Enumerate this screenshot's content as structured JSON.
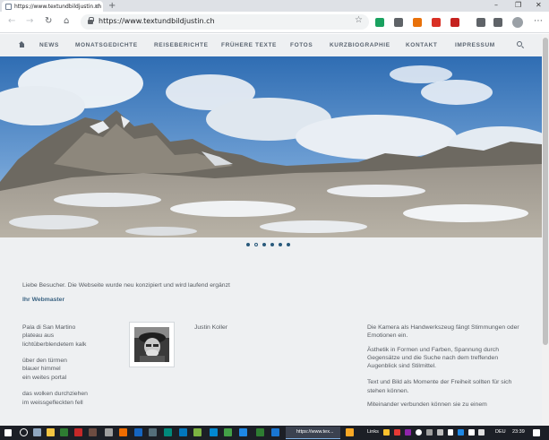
{
  "browser": {
    "tab_title": "https://www.textundbildjustin.ch",
    "new_tab": "+",
    "tab_close": "×",
    "window_minimize": "–",
    "window_maximize": "❐",
    "window_close": "✕",
    "url": "https://www.textundbildjustin.ch",
    "extension_colors": [
      "#1aa260",
      "#5f6368",
      "#e8710a",
      "#d93025",
      "#c5221f",
      "#5f6368",
      "#5f6368"
    ]
  },
  "site": {
    "nav": [
      "NEWS",
      "MONATSGEDICHTE",
      "REISEBERICHTE",
      "FRÜHERE TEXTE",
      "FOTOS",
      "KURZBIOGRAPHIE",
      "KONTAKT",
      "IMPRESSUM"
    ],
    "slider": {
      "slide_count": 6,
      "active_index": 1
    },
    "greeting": "Liebe Besucher. Die Webseite wurde neu konzipiert und wird laufend ergänzt",
    "signature": "Ihr Webmaster",
    "poem": "Pala di San Martino\nplateau aus\nlichtüberblendetem kalk\n\nüber den türmen\nblauer himmel\nein weites portal\n\ndas wolken durchziehen\nim weissgefleckten fell",
    "author": "Justin Koller",
    "right_paragraphs": [
      "Die Kamera als Handwerkszeug fängt Stimmungen oder Emotionen ein.",
      "Ästhetik in Formen und Farben, Spannung durch Gegensätze und die Suche nach dem treffenden Augenblick sind Stilmittel.",
      "Text und Bild als Momente der Freiheit sollten für sich stehen können.",
      "Miteinander verbunden können sie zu einem"
    ]
  },
  "taskbar": {
    "active_app": "https://www.tex...",
    "links_label": "Links",
    "language": "DEU",
    "time": "23:39"
  }
}
